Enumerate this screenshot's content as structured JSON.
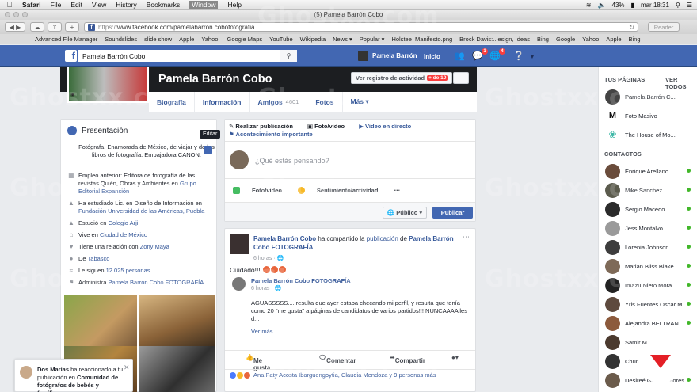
{
  "os": {
    "menu": [
      "Safari",
      "File",
      "Edit",
      "View",
      "History",
      "Bookmarks",
      "Window",
      "Help"
    ],
    "status_right": {
      "battery": "43%",
      "date": "mar 18:31"
    },
    "window_title": "(5) Pamela Barrón Cobo"
  },
  "browser": {
    "url_scheme": "https://",
    "url_rest": "www.facebook.com/pamelabarron.cobofotografia",
    "reader": "Reader",
    "bookmarks": [
      "Advanced File Manager",
      "Soundslides",
      "slide show",
      "Apple",
      "Yahoo!",
      "Google Maps",
      "YouTube",
      "Wikipedia",
      "News ▾",
      "Popular ▾",
      "Holstee–Manifesto.png",
      "Brock Davis:...esign, Ideas",
      "Bing",
      "Google",
      "Yahoo",
      "Apple",
      "Bing"
    ]
  },
  "fb": {
    "search_value": "Pamela Barrón Cobo",
    "user_name": "Pamela Barrón",
    "home": "Inicio",
    "msg_badge": "1",
    "notif_badge": "4"
  },
  "profile": {
    "name": "Pamela Barrón Cobo",
    "activity": "Ver registro de actividad",
    "activity_badge": "+ de 10",
    "tabs": [
      {
        "label": "Biografía",
        "count": ""
      },
      {
        "label": "Información",
        "count": ""
      },
      {
        "label": "Amigos",
        "count": "4601"
      },
      {
        "label": "Fotos",
        "count": ""
      },
      {
        "label": "Más ▾",
        "count": ""
      }
    ]
  },
  "intro": {
    "title": "Presentación",
    "bio": "Fotógrafa. Enamorada de México, de viajar y de los libros de fotografía. Embajadora CANON.",
    "tooltip": "Editar",
    "rows": [
      {
        "icon": "briefcase-icon",
        "text": "Empleo anterior: Editora de fotografía de las revistas Quién, Obras y Ambientes en ",
        "link": "Grupo Editorial Expansión"
      },
      {
        "icon": "graduation-icon",
        "text": "Ha estudiado Lic. en Diseño de Información en ",
        "link": "Fundación Universidad de las Américas, Puebla"
      },
      {
        "icon": "graduation-icon",
        "text": "Estudió en ",
        "link": "Colegio Arji"
      },
      {
        "icon": "home-icon",
        "text": "Vive en ",
        "link": "Ciudad de México"
      },
      {
        "icon": "heart-icon",
        "text": "Tiene una relación con ",
        "link": "Zony Maya"
      },
      {
        "icon": "pin-icon",
        "text": "De ",
        "link": "Tabasco"
      },
      {
        "icon": "rss-icon",
        "text": "Le siguen ",
        "link": "12 025 personas"
      },
      {
        "icon": "flag-icon",
        "text": "Administra ",
        "link": "Pamela Barrón Cobo FOTOGRAFÍA"
      }
    ]
  },
  "composer": {
    "tab_post": "Realizar publicación",
    "tab_photo": "Foto/video",
    "tab_live": "Video en directo",
    "tab_event": "Acontecimiento importante",
    "placeholder": "¿Qué estás pensando?",
    "act_photo": "Foto/video",
    "act_feel": "Sentimiento/actividad",
    "privacy": "Público ▾",
    "publish": "Publicar"
  },
  "post": {
    "author": "Pamela Barrón Cobo",
    "verb": " ha compartido la ",
    "obj": "publicación",
    "of": " de ",
    "page": "Pamela Barrón Cobo FOTOGRAFÍA",
    "time": "6 horas · ",
    "message": "Cuidado!!!",
    "shared_name": "Pamela Barrón Cobo FOTOGRAFÍA",
    "shared_time": "6 horas · ",
    "shared_text": "AGUASSSSS.... resulta que ayer estaba checando mi perfil, y resulta que tenía como 20 \"me gusta\" a páginas de candidatos de varios partidos!!! NUNCAAAA les d...",
    "see_more": "Ver más",
    "like": "Me gusta",
    "comment": "Comentar",
    "share": "Compartir",
    "reactions": "Ana Paty Acosta Ibarguengoytia, Claudia Mendoza y 9 personas más"
  },
  "chat": {
    "pages_title": "TUS PÁGINAS",
    "see_all": "VER TODOS",
    "pages": [
      "Pamela Barrón C...",
      "Foto Masivo",
      "The House of Mo..."
    ],
    "contacts_title": "CONTACTOS",
    "contacts": [
      "Enrique Arellano",
      "Mike Sanchez",
      "Sergio Macedo",
      "Jess Montalvo",
      "Lorenia Johnson",
      "Marian Bliss Blake",
      "Imazu Nieto Mora",
      "Yris Fuentes Oscar M...",
      "Alejandra BELTRAN",
      "Samir M...",
      "Chuma...",
      "Desireé Gómez Flores"
    ]
  },
  "notification": {
    "actor": "Dos Marías",
    "text": " ha reaccionado a tu publicación en ",
    "group": "Comunidad de fotógrafos de bebés y familias",
    "tail": "..."
  },
  "watermark": "Ghostxx.com"
}
